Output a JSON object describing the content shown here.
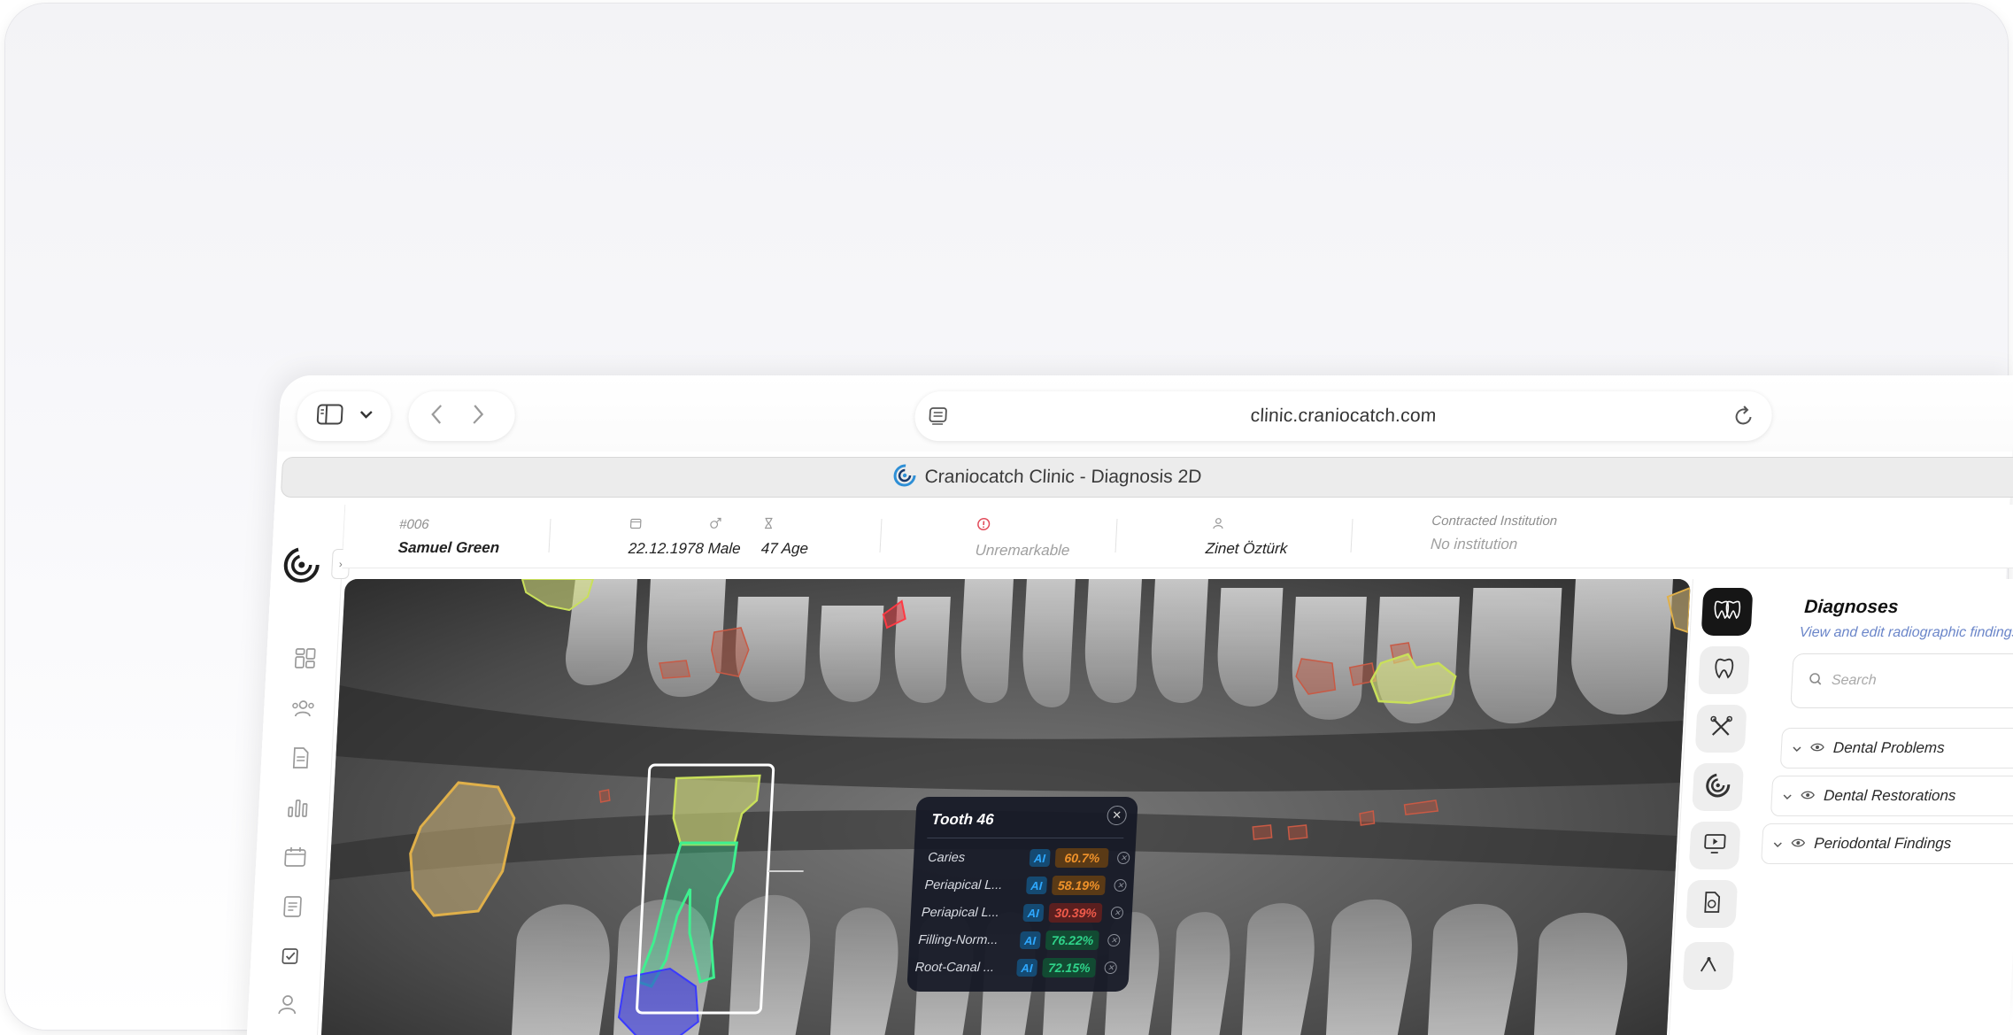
{
  "browser": {
    "url": "clinic.craniocatch.com",
    "tab_title": "Craniocatch Clinic - Diagnosis 2D"
  },
  "patient": {
    "id": "#006",
    "name": "Samuel Green",
    "birth_date": "22.12.1978",
    "gender": "Male",
    "age": "47 Age",
    "medical_status": "Unremarkable",
    "doctor": "Zinet Öztürk",
    "institution_label": "Contracted Institution",
    "institution_value": "No institution"
  },
  "diagnoses": {
    "title": "Diagnoses",
    "subtitle": "View and edit radiographic findings",
    "search_placeholder": "Search",
    "groups": [
      "Dental Problems",
      "Dental Restorations",
      "Periodontal Findings"
    ]
  },
  "tooth_popup": {
    "title": "Tooth 46",
    "ai_label": "AI",
    "findings": [
      {
        "name": "Caries",
        "confidence": "60.7%",
        "level": "orange"
      },
      {
        "name": "Periapical L...",
        "confidence": "58.19%",
        "level": "orange"
      },
      {
        "name": "Periapical L...",
        "confidence": "30.39%",
        "level": "red"
      },
      {
        "name": "Filling-Norm...",
        "confidence": "76.22%",
        "level": "green"
      },
      {
        "name": "Root-Canal ...",
        "confidence": "72.15%",
        "level": "green"
      }
    ]
  },
  "colors": {
    "orange": "#f0922a",
    "red": "#ef5a4a",
    "green": "#2fd38a",
    "accent_blue": "#6b86c9"
  },
  "icons": {
    "sidebar": [
      "dashboard-icon",
      "patients-icon",
      "document-icon",
      "chart-icon",
      "calendar-icon",
      "notes-icon",
      "checklist-icon",
      "user-icon"
    ],
    "tools": [
      "teeth-icon",
      "tooth-icon",
      "instruments-icon",
      "logo-icon",
      "monitor-icon",
      "report-icon",
      "measure-icon"
    ]
  }
}
